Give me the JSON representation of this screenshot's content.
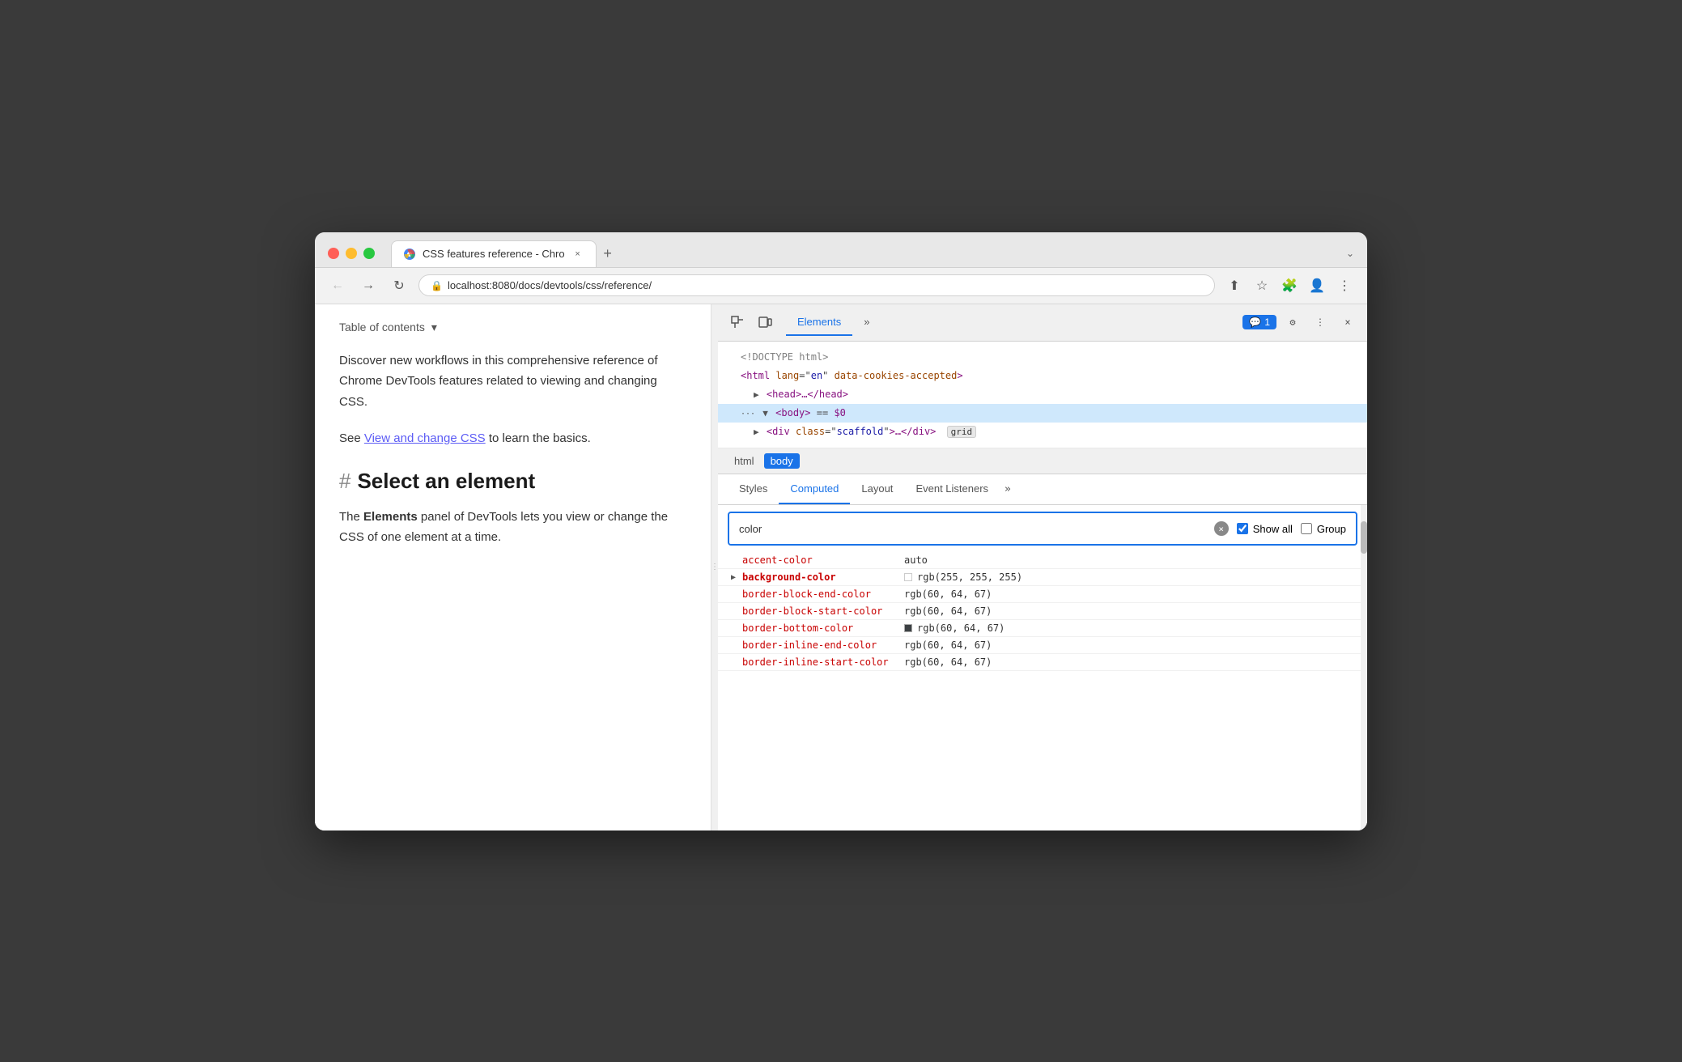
{
  "browser": {
    "tab_title": "CSS features reference - Chro",
    "tab_close": "×",
    "tab_new": "+",
    "chevron": "⌄",
    "url": "localhost:8080/docs/devtools/css/reference/",
    "nav_back": "←",
    "nav_forward": "→",
    "nav_reload": "↻"
  },
  "page": {
    "toc_label": "Table of contents",
    "intro_text": "Discover new workflows in this comprehensive reference of Chrome DevTools features related to viewing and changing CSS.",
    "link_text": "View and change CSS",
    "after_link": " to learn the basics.",
    "see_prefix": "See ",
    "section_hash": "#",
    "section_title": "Select an element",
    "elements_bold": "Elements",
    "body_text": "The Elements panel of DevTools lets you view or change the CSS of one element at a time."
  },
  "devtools": {
    "toolbar": {
      "inspector_icon": "⬚",
      "device_icon": "⬜",
      "more_icon": "»",
      "settings_icon": "⚙",
      "dots_icon": "⋮",
      "close_icon": "×",
      "badge_icon": "💬",
      "badge_count": "1"
    },
    "tabs": [
      {
        "label": "Elements",
        "active": true
      },
      {
        "label": "»",
        "active": false
      }
    ],
    "dom": {
      "lines": [
        {
          "text": "<!DOCTYPE html>",
          "indent": 0,
          "type": "comment"
        },
        {
          "text": "<html lang=\"en\" data-cookies-accepted>",
          "indent": 1,
          "type": "tag"
        },
        {
          "text": "▶ <head>…</head>",
          "indent": 2,
          "type": "collapsed"
        },
        {
          "text": "▼ <body> == $0",
          "indent": 1,
          "type": "selected",
          "selected": true
        },
        {
          "text": "▶ <div class=\"scaffold\">…</div>",
          "indent": 2,
          "type": "child",
          "badge": "grid"
        }
      ]
    },
    "breadcrumb": {
      "items": [
        {
          "label": "html",
          "active": false
        },
        {
          "label": "body",
          "active": true
        }
      ]
    },
    "styles_tabs": [
      {
        "label": "Styles",
        "active": false
      },
      {
        "label": "Computed",
        "active": true
      },
      {
        "label": "Layout",
        "active": false
      },
      {
        "label": "Event Listeners",
        "active": false
      },
      {
        "label": "»",
        "active": false
      }
    ],
    "filter": {
      "placeholder": "color",
      "value": "color",
      "show_all_label": "Show all",
      "group_label": "Group"
    },
    "properties": [
      {
        "name": "accent-color",
        "value": "auto",
        "expandable": false,
        "bold": false,
        "swatch": null
      },
      {
        "name": "background-color",
        "value": "rgb(255, 255, 255)",
        "expandable": true,
        "bold": true,
        "swatch": "white"
      },
      {
        "name": "border-block-end-color",
        "value": "rgb(60, 64, 67)",
        "expandable": false,
        "bold": false,
        "swatch": null
      },
      {
        "name": "border-block-start-color",
        "value": "rgb(60, 64, 67)",
        "expandable": false,
        "bold": false,
        "swatch": null
      },
      {
        "name": "border-bottom-color",
        "value": "rgb(60, 64, 67)",
        "expandable": false,
        "bold": false,
        "swatch": "dark-gray"
      },
      {
        "name": "border-inline-end-color",
        "value": "rgb(60, 64, 67)",
        "expandable": false,
        "bold": false,
        "swatch": null
      },
      {
        "name": "border-inline-start-color",
        "value": "rgb(60, 64, 67)",
        "expandable": false,
        "bold": false,
        "swatch": null
      }
    ]
  }
}
